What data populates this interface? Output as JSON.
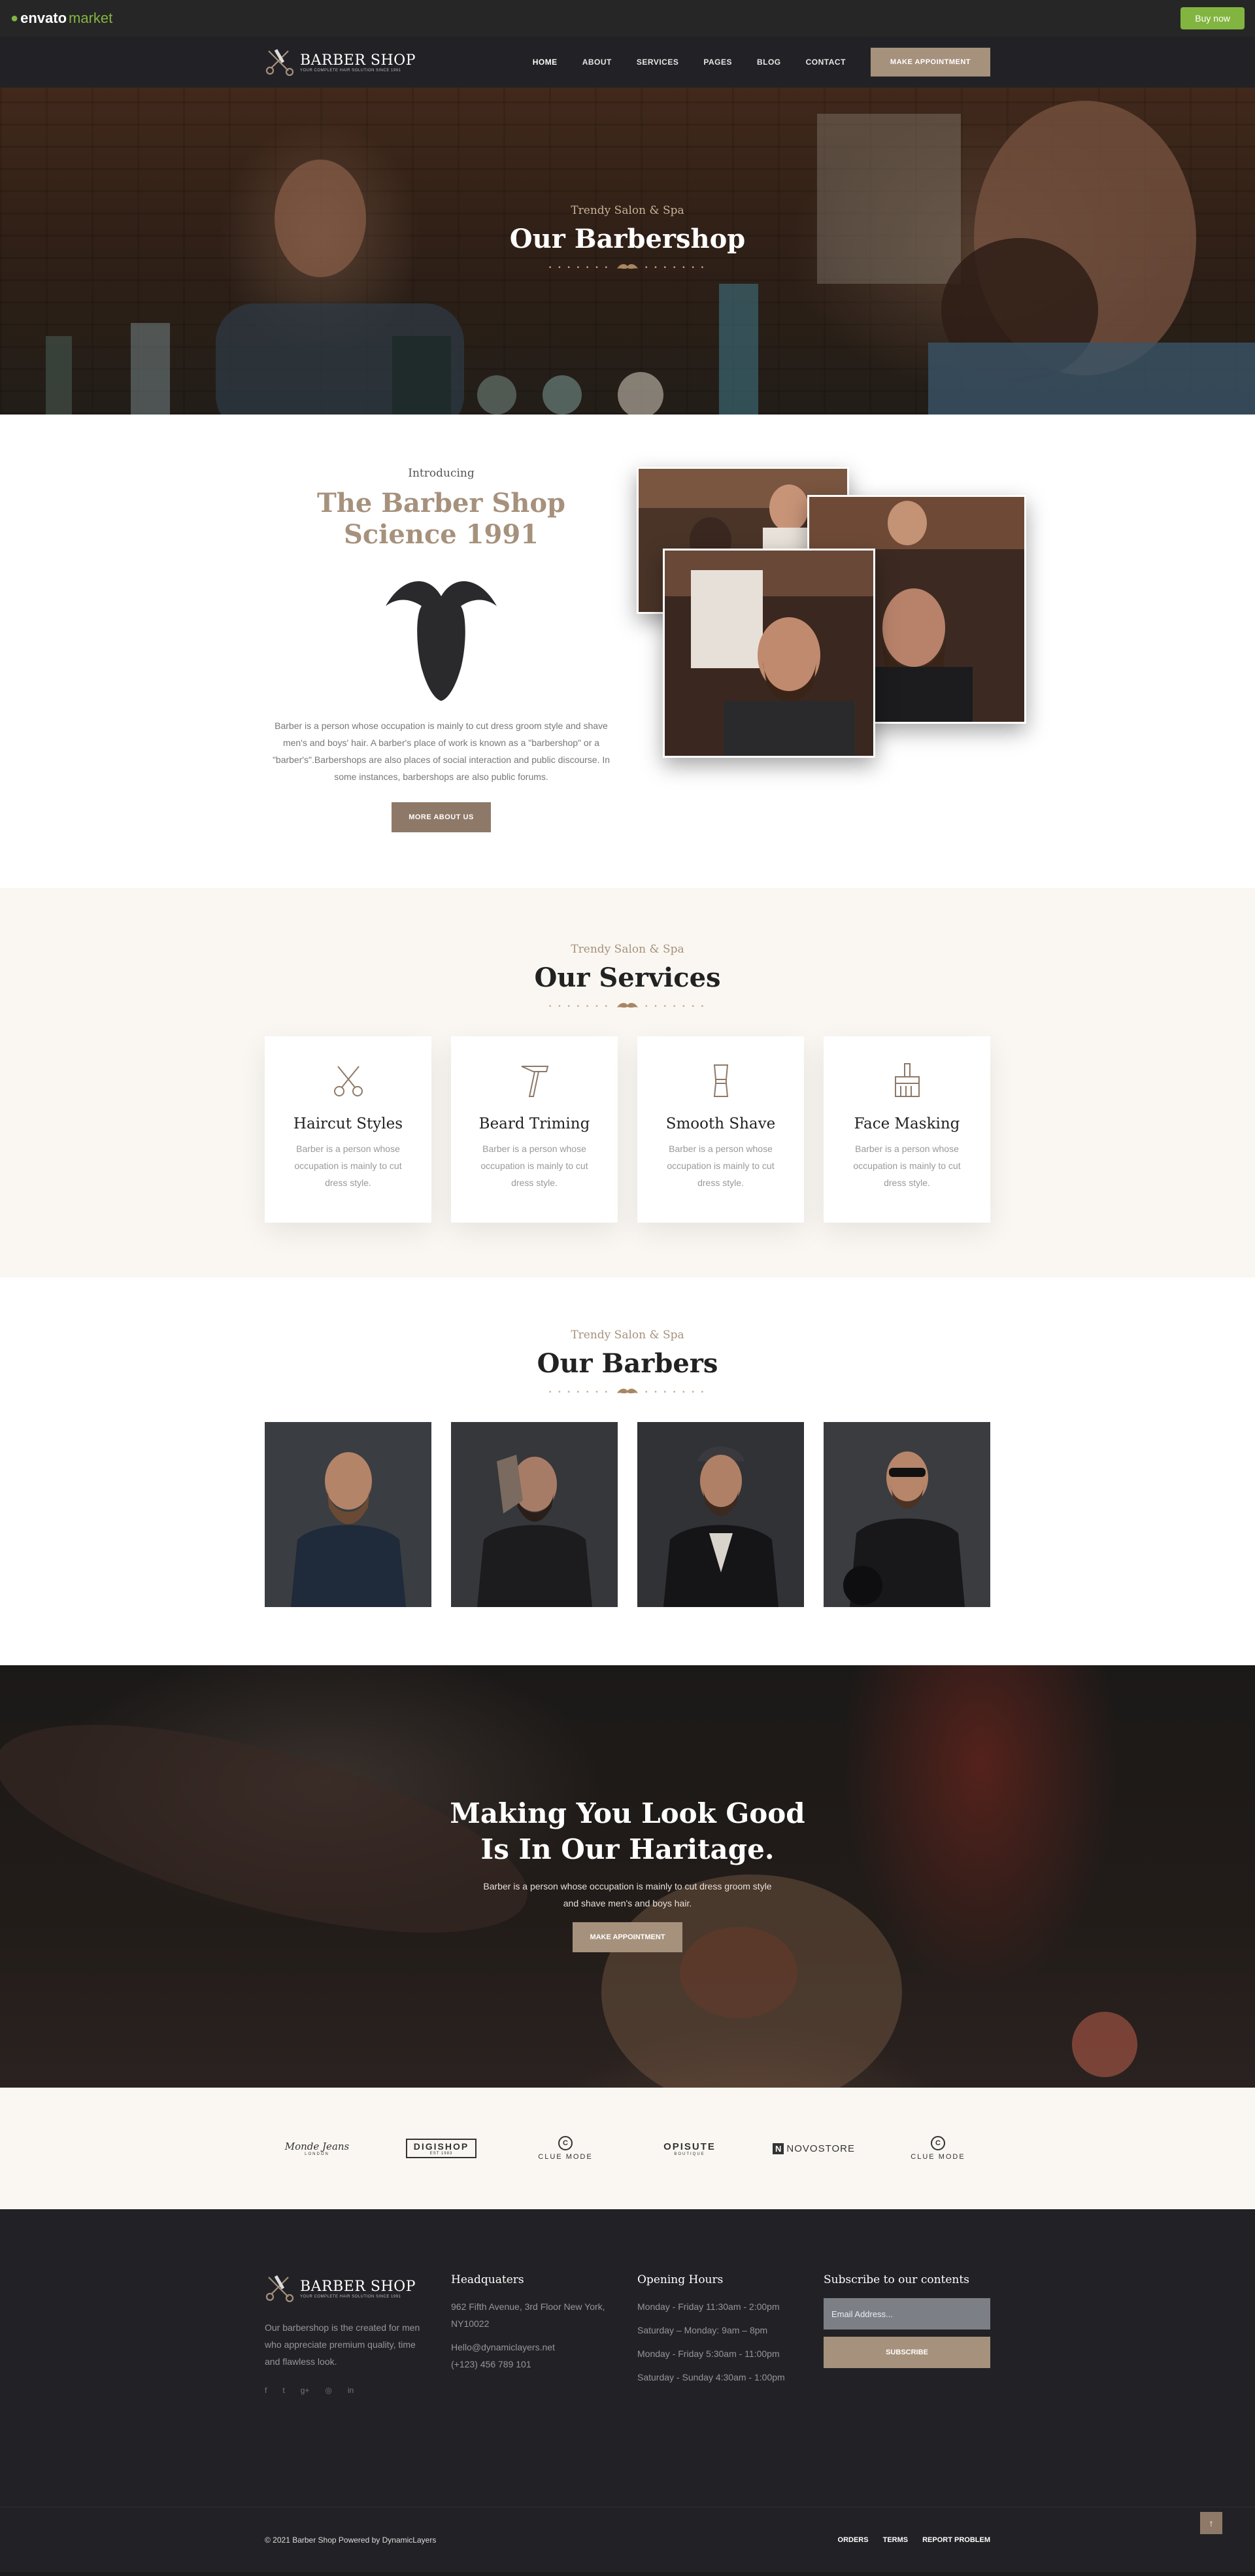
{
  "envato": {
    "logo_main": "envato",
    "logo_market": "market",
    "buy_label": "Buy now",
    "brand_color": "#82b540"
  },
  "header": {
    "brand_name": "BARBER SHOP",
    "brand_tag": "YOUR COMPLETE HAIR SOLUTION SINCE 1991",
    "nav": [
      "HOME",
      "ABOUT",
      "SERVICES",
      "PAGES",
      "BLOG",
      "CONTACT"
    ],
    "appointment": "MAKE APPOINTMENT",
    "accent": "#a6917c"
  },
  "hero": {
    "subtitle": "Trendy Salon & Spa",
    "title": "Our Barbershop"
  },
  "about": {
    "intro": "Introducing",
    "title_line1": "The Barber Shop",
    "title_line2": "Science 1991",
    "text": "Barber is a person whose occupation is mainly to cut dress groom style and shave men's and boys' hair. A barber's place of work is known as a \"barbershop\" or a \"barber's\".Barbershops are also places of social interaction and public discourse. In some instances, barbershops are also public forums.",
    "button": "MORE ABOUT US"
  },
  "services": {
    "subtitle": "Trendy Salon & Spa",
    "title": "Our Services",
    "items": [
      {
        "title": "Haircut Styles",
        "text": "Barber is a person whose occupation is mainly to cut dress style.",
        "icon": "scissors-icon"
      },
      {
        "title": "Beard Triming",
        "text": "Barber is a person whose occupation is mainly to cut dress style.",
        "icon": "razor-icon"
      },
      {
        "title": "Smooth Shave",
        "text": "Barber is a person whose occupation is mainly to cut dress style.",
        "icon": "shaving-brush-icon"
      },
      {
        "title": "Face Masking",
        "text": "Barber is a person whose occupation is mainly to cut dress style.",
        "icon": "brush-icon"
      }
    ]
  },
  "barbers": {
    "subtitle": "Trendy Salon & Spa",
    "title": "Our Barbers"
  },
  "cta": {
    "title_line1": "Making You Look Good",
    "title_line2": "Is In Our Haritage.",
    "text": "Barber is a person whose occupation is mainly to cut dress groom style and shave men's and boys hair.",
    "button": "MAKE APPOINTMENT"
  },
  "partners": [
    {
      "name": "Monde Jeans",
      "sub": "LONDON"
    },
    {
      "name": "DIGISHOP",
      "sub": "EST 1983"
    },
    {
      "name": "CLUE MODE",
      "sub": ""
    },
    {
      "name": "OPISUTE",
      "sub": "BOUTIQUE"
    },
    {
      "name": "NOVOSTORE",
      "sub": ""
    },
    {
      "name": "CLUE MODE",
      "sub": ""
    }
  ],
  "footer": {
    "about": "Our barbershop is the created for men who appreciate premium quality, time and flawless look.",
    "hq_title": "Headquaters",
    "hq_address": "962 Fifth Avenue, 3rd Floor New York, NY10022",
    "hq_email": "Hello@dynamiclayers.net",
    "hq_phone": "(+123) 456 789 101",
    "hours_title": "Opening Hours",
    "hours": [
      "Monday - Friday 11:30am - 2:00pm",
      "Saturday – Monday: 9am – 8pm",
      "Monday - Friday 5:30am - 11:00pm",
      "Saturday - Sunday 4:30am - 1:00pm"
    ],
    "subscribe_title": "Subscribe to our contents",
    "email_placeholder": "Email Address...",
    "subscribe_button": "SUBSCRIBE",
    "copyright": "© 2021 Barber Shop Powered by DynamicLayers",
    "links": [
      "ORDERS",
      "TERMS",
      "REPORT PROBLEM"
    ],
    "social": [
      "facebook-icon",
      "twitter-icon",
      "google-plus-icon",
      "instagram-icon",
      "linkedin-icon"
    ]
  }
}
